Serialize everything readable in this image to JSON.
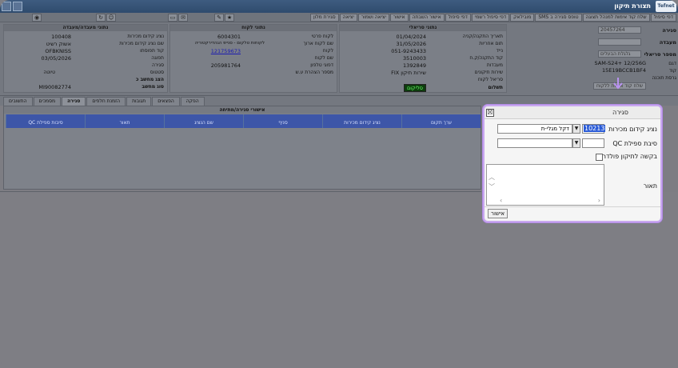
{
  "window": {
    "title": "תצורת תיקון",
    "logo": "Tefnet"
  },
  "toolbar": {
    "buttons": [
      "דפי סיפול",
      "שלח קוד אימות למנהל תצוגה",
      "טופס סגירה ב SMS",
      "מובילאק",
      "דפי סיפול רשמי",
      "דפי סיפול",
      "אישור השבתה",
      "אישור",
      "יציאה ושמור",
      "יציאה",
      "סגירת מלון"
    ]
  },
  "form": {
    "left_labels": [
      "סגירה",
      "מעבדה",
      "מספר סריאלי",
      "דגם",
      "קוד",
      "גרסת תוכנה"
    ],
    "left_inputs": {
      "closure_code": "20457264",
      "lab": "",
      "serial_hint": "גלגלת הבעלים"
    },
    "left_values": {
      "model": "SAM-S24+ 12/256G",
      "code": "15E19BCCB1BF4"
    },
    "service_button": "שלח קוד אימות ללקוח",
    "panel_serial": {
      "header": "נתוני סריאלי",
      "rows": [
        {
          "label": "תאריך התקנה/קניה",
          "value": "01/04/2024"
        },
        {
          "label": "תום אחריות",
          "value": "31/05/2026"
        },
        {
          "label": "נייד",
          "value": "051-9243433"
        },
        {
          "label": "קוד התקנה/ק.ח",
          "value": "3510003"
        },
        {
          "label": "מעבדות",
          "value": "1392849"
        },
        {
          "label": "שירות תיקונים",
          "value": "שירות תיקון FIX"
        },
        {
          "label": "סריאל לקוח",
          "value": ""
        },
        {
          "label": "תשלום",
          "value": ""
        }
      ],
      "status": "סליקום"
    },
    "panel_customer": {
      "header": "נתוני לקוח",
      "rows": [
        {
          "label": "לקוח פרטי",
          "value": "6004301"
        },
        {
          "label": "שם לקוח ארוך",
          "value": "לקוחות טלקום - סנייפ הגהדירקטוריה"
        },
        {
          "label": "לקוח",
          "value": "121759673"
        },
        {
          "label": "שם לקוח",
          "value": ""
        },
        {
          "label": "דפוגי טלפון",
          "value": "205981764"
        },
        {
          "label": "מספר הצהרת ע.ש",
          "value": ""
        }
      ]
    },
    "panel_lab": {
      "header": "נתוני מעבדה/מעבדה",
      "rows": [
        {
          "label": "נציג קידום מכירות",
          "value": "100408"
        },
        {
          "label": "שם נציג קידום מכירות",
          "value": "אשוק רשיט"
        },
        {
          "label": "קוד תפוסתו",
          "value": "OFBKNISS"
        },
        {
          "label": "תפוגה",
          "value": "03/05/2026"
        },
        {
          "label": "סגירה",
          "value": ""
        },
        {
          "label": "סטטוס",
          "value": ""
        },
        {
          "label": "הצג מחשב כ",
          "value": ""
        },
        {
          "label": "סוג מחשב",
          "value": "MI90082774"
        }
      ],
      "side_label": "טיוטה"
    }
  },
  "tabs": [
    "התשובים",
    "מסמכים",
    "סגירה",
    "הזמנת חלפים",
    "תגובות",
    "הפצאים",
    "הפקה"
  ],
  "active_tab": "סגירה",
  "grid": {
    "caption": "אישורי סגירה/מתיחה",
    "columns": [
      "ערך תקום",
      "נציג קידום מכירות",
      "סניף",
      "שם הנציג",
      "תאור",
      "סיבות ספילת QC"
    ]
  },
  "popup": {
    "title": "סגירה",
    "close": "☒",
    "fields": {
      "rep_label": "נציג קידום מכירות",
      "rep_code": "10213",
      "rep_name": "דקל מגלי-ת",
      "qc_label": "סיבת ספילת QC",
      "qc_value": "",
      "folder_label": "בקשה לתיקון פולדר",
      "desc_label": "תאור",
      "ok_label": "אישור"
    }
  },
  "colors": {
    "accent_popup_border": "#c9a8f0",
    "grid_header": "#3d56a8",
    "status_green": "#66ff66"
  }
}
